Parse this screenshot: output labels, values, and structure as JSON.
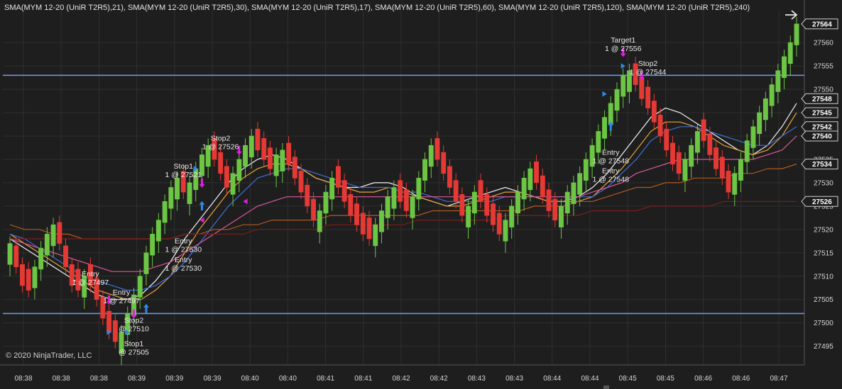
{
  "window": {
    "legend": "SMA(MYM 12-20 (UniR T2R5),21), SMA(MYM 12-20 (UniR T2R5),30), SMA(MYM 12-20 (UniR T2R5),17), SMA(MYM 12-20 (UniR T2R5),60), SMA(MYM 12-20 (UniR T2R5),120), SMA(MYM 12-20 (UniR T2R5),240)",
    "copyright": "© 2020 NinjaTrader, LLC",
    "nav_icon": "arrow-right-icon"
  },
  "colors": {
    "background": "#1e1e1e",
    "grid": "#2f2f2f",
    "up": "#6cc644",
    "down": "#e53935",
    "level_line": "#6f95e8",
    "marker_long": "#2e8be8",
    "marker_short": "#e020e0"
  },
  "chart_data": {
    "type": "candlestick",
    "instrument": "MYM 12-20 (UniR T2R5)",
    "ylim": [
      27491,
      27567
    ],
    "y_ticks": [
      27495,
      27500,
      27505,
      27510,
      27515,
      27520,
      27525,
      27530,
      27535,
      27540,
      27545,
      27550,
      27555,
      27560
    ],
    "x_tick_labels": [
      "08:38",
      "08:38",
      "08:38",
      "08:39",
      "08:39",
      "08:39",
      "08:40",
      "08:40",
      "08:41",
      "08:41",
      "08:42",
      "08:42",
      "08:43",
      "08:43",
      "08:44",
      "08:44",
      "08:45",
      "08:45",
      "08:46",
      "08:46",
      "08:47"
    ],
    "price_labels": [
      {
        "value": 27564,
        "text": "27564",
        "bg": "#1e1e1e",
        "fg": "#ffffff"
      },
      {
        "value": 27548,
        "text": "27548",
        "bg": "#1e1e1e",
        "fg": "#ffffff"
      },
      {
        "value": 27545,
        "text": "27545",
        "bg": "#1e1e1e",
        "fg": "#ffffff"
      },
      {
        "value": 27542,
        "text": "27542",
        "bg": "#1e1e1e",
        "fg": "#ffffff"
      },
      {
        "value": 27540,
        "text": "27540",
        "bg": "#1e1e1e",
        "fg": "#ffffff"
      },
      {
        "value": 27534,
        "text": "27534",
        "bg": "#1e1e1e",
        "fg": "#ffffff"
      },
      {
        "value": 27526,
        "text": "27526",
        "bg": "#1e1e1e",
        "fg": "#ffffff"
      }
    ],
    "horizontal_levels": [
      27553,
      27502
    ],
    "close_path": [
      27517,
      27512,
      27508,
      27507,
      27512,
      27516,
      27519,
      27521,
      27517,
      27512,
      27508,
      27507,
      27510,
      27508,
      27505,
      27501,
      27498,
      27496,
      27498,
      27502,
      27506,
      27510,
      27515,
      27519,
      27522,
      27526,
      27529,
      27531,
      27528,
      27530,
      27533,
      27536,
      27538,
      27535,
      27532,
      27529,
      27532,
      27535,
      27538,
      27540,
      27537,
      27535,
      27533,
      27536,
      27537,
      27534,
      27531,
      27528,
      27525,
      27522,
      27524,
      27528,
      27531,
      27529,
      27526,
      27523,
      27521,
      27519,
      27518,
      27521,
      27524,
      27527,
      27529,
      27526,
      27524,
      27527,
      27531,
      27535,
      27538,
      27535,
      27532,
      27529,
      27526,
      27523,
      27525,
      27528,
      27526,
      27523,
      27521,
      27519,
      27522,
      27525,
      27528,
      27531,
      27533,
      27530,
      27527,
      27524,
      27522,
      27525,
      27528,
      27530,
      27532,
      27535,
      27538,
      27541,
      27544,
      27547,
      27550,
      27553,
      27554,
      27551,
      27548,
      27546,
      27543,
      27540,
      27537,
      27534,
      27532,
      27535,
      27538,
      27541,
      27539,
      27536,
      27533,
      27531,
      27528,
      27532,
      27535,
      27539,
      27542,
      27545,
      27548,
      27551,
      27554,
      27557,
      27560,
      27564
    ],
    "series": [
      {
        "name": "SMA(MYM 12-20 (UniR T2R5),17)",
        "color": "#f2f2f2",
        "values": [
          27518,
          27516,
          27514,
          27512,
          27510,
          27508,
          27506,
          27505,
          27505,
          27506,
          27509,
          27513,
          27518,
          27522,
          27526,
          27530,
          27533,
          27535,
          27536,
          27535,
          27533,
          27531,
          27530,
          27529,
          27529,
          27530,
          27530,
          27529,
          27527,
          27526,
          27525,
          27526,
          27527,
          27528,
          27529,
          27528,
          27527,
          27526,
          27526,
          27527,
          27529,
          27532,
          27536,
          27540,
          27544,
          27546,
          27545,
          27543,
          27541,
          27539,
          27537,
          27536,
          27538,
          27542,
          27547
        ]
      },
      {
        "name": "SMA(MYM 12-20 (UniR T2R5),21)",
        "color": "#e8a23a",
        "values": [
          27519,
          27517,
          27515,
          27513,
          27511,
          27509,
          27507,
          27506,
          27505,
          27505,
          27507,
          27510,
          27515,
          27520,
          27524,
          27528,
          27531,
          27533,
          27534,
          27534,
          27533,
          27531,
          27530,
          27529,
          27528,
          27528,
          27529,
          27528,
          27527,
          27526,
          27525,
          27525,
          27526,
          27527,
          27528,
          27528,
          27527,
          27526,
          27526,
          27526,
          27527,
          27530,
          27533,
          27537,
          27541,
          27543,
          27543,
          27542,
          27540,
          27538,
          27537,
          27536,
          27537,
          27540,
          27545
        ]
      },
      {
        "name": "SMA(MYM 12-20 (UniR T2R5),30)",
        "color": "#3f6fd8",
        "values": [
          27519,
          27518,
          27516,
          27514,
          27512,
          27510,
          27509,
          27508,
          27507,
          27507,
          27508,
          27510,
          27513,
          27517,
          27521,
          27525,
          27528,
          27531,
          27532,
          27533,
          27533,
          27532,
          27531,
          27530,
          27529,
          27529,
          27529,
          27528,
          27528,
          27527,
          27526,
          27526,
          27526,
          27526,
          27527,
          27527,
          27527,
          27527,
          27527,
          27527,
          27527,
          27529,
          27532,
          27535,
          27539,
          27541,
          27542,
          27542,
          27541,
          27540,
          27539,
          27538,
          27538,
          27540,
          27542
        ]
      },
      {
        "name": "SMA(MYM 12-20 (UniR T2R5),60)",
        "color": "#d9579a",
        "values": [
          27518,
          27517,
          27516,
          27515,
          27514,
          27513,
          27512,
          27511,
          27511,
          27511,
          27512,
          27513,
          27515,
          27517,
          27519,
          27521,
          27523,
          27525,
          27526,
          27527,
          27527,
          27527,
          27527,
          27527,
          27527,
          27527,
          27527,
          27527,
          27527,
          27527,
          27527,
          27527,
          27527,
          27527,
          27527,
          27527,
          27527,
          27527,
          27527,
          27527,
          27528,
          27529,
          27530,
          27532,
          27533,
          27534,
          27535,
          27535,
          27535,
          27535,
          27535,
          27535,
          27536,
          27537,
          27540
        ]
      },
      {
        "name": "SMA(MYM 12-20 (UniR T2R5),120)",
        "color": "#b2581e",
        "values": [
          27521,
          27520,
          27520,
          27519,
          27519,
          27518,
          27518,
          27518,
          27518,
          27518,
          27518,
          27518,
          27519,
          27519,
          27520,
          27520,
          27521,
          27521,
          27522,
          27522,
          27522,
          27522,
          27523,
          27523,
          27523,
          27523,
          27523,
          27523,
          27523,
          27524,
          27524,
          27524,
          27524,
          27524,
          27524,
          27524,
          27525,
          27525,
          27525,
          27526,
          27526,
          27527,
          27528,
          27529,
          27529,
          27530,
          27530,
          27531,
          27531,
          27531,
          27532,
          27532,
          27533,
          27533,
          27534
        ]
      },
      {
        "name": "SMA(MYM 12-20 (UniR T2R5),240)",
        "color": "#7a1d1d",
        "values": [
          27518,
          27518,
          27518,
          27518,
          27518,
          27518,
          27518,
          27518,
          27518,
          27518,
          27518,
          27518,
          27519,
          27519,
          27519,
          27519,
          27519,
          27520,
          27520,
          27520,
          27520,
          27520,
          27521,
          27521,
          27521,
          27521,
          27521,
          27521,
          27522,
          27522,
          27522,
          27522,
          27522,
          27522,
          27523,
          27523,
          27523,
          27523,
          27523,
          27523,
          27524,
          27524,
          27524,
          27524,
          27525,
          27525,
          27525,
          27525,
          27525,
          27526,
          27526,
          27526,
          27526,
          27526,
          27526
        ]
      }
    ],
    "annotations": [
      {
        "lines": [
          "Entry",
          "1 @ 27497"
        ],
        "value": 27510,
        "bar": 13
      },
      {
        "lines": [
          "Entry",
          "1 @ 27497"
        ],
        "value": 27506,
        "bar": 18
      },
      {
        "lines": [
          "Stop2",
          "@ 27510"
        ],
        "value": 27500,
        "bar": 20
      },
      {
        "lines": [
          "Stop1",
          "@ 27505"
        ],
        "value": 27495,
        "bar": 20
      },
      {
        "lines": [
          "Stop1",
          "1 @ 27521"
        ],
        "value": 27533,
        "bar": 28
      },
      {
        "lines": [
          "Entry",
          "1 @ 27530"
        ],
        "value": 27517,
        "bar": 28
      },
      {
        "lines": [
          "Entry",
          "1 @ 27530"
        ],
        "value": 27513,
        "bar": 28
      },
      {
        "lines": [
          "Stop2",
          "1 @ 27526"
        ],
        "value": 27539,
        "bar": 34
      },
      {
        "lines": [
          "Target1",
          "1 @ 27556"
        ],
        "value": 27560,
        "bar": 99
      },
      {
        "lines": [
          "Stop2",
          "1 @ 27544"
        ],
        "value": 27555,
        "bar": 103
      },
      {
        "lines": [
          "Entry",
          "1 @ 27548"
        ],
        "value": 27536,
        "bar": 97
      },
      {
        "lines": [
          "Entry",
          "1 @ 27548"
        ],
        "value": 27532,
        "bar": 97
      }
    ],
    "markers": [
      {
        "bar": 16,
        "value": 27505,
        "dir": "down",
        "type": "arrow"
      },
      {
        "bar": 20,
        "value": 27502,
        "dir": "down",
        "type": "arrow"
      },
      {
        "bar": 22,
        "value": 27503,
        "dir": "up",
        "type": "arrow"
      },
      {
        "bar": 31,
        "value": 27525,
        "dir": "up",
        "type": "arrow"
      },
      {
        "bar": 31,
        "value": 27530,
        "dir": "down",
        "type": "arrow"
      },
      {
        "bar": 37,
        "value": 27537,
        "dir": "down",
        "type": "arrow"
      },
      {
        "bar": 97,
        "value": 27542,
        "dir": "up",
        "type": "arrow"
      },
      {
        "bar": 99,
        "value": 27558,
        "dir": "down",
        "type": "arrow"
      },
      {
        "bar": 102,
        "value": 27553,
        "dir": "down",
        "type": "arrow"
      },
      {
        "bar": 16,
        "value": 27498,
        "dir": "right",
        "type": "tri"
      },
      {
        "bar": 19,
        "value": 27498,
        "dir": "right",
        "type": "tri"
      },
      {
        "bar": 30,
        "value": 27533,
        "dir": "right",
        "type": "tri"
      },
      {
        "bar": 31,
        "value": 27522,
        "dir": "left",
        "type": "tri"
      },
      {
        "bar": 38,
        "value": 27526,
        "dir": "left",
        "type": "tri"
      },
      {
        "bar": 96,
        "value": 27549,
        "dir": "right",
        "type": "tri"
      },
      {
        "bar": 99,
        "value": 27555,
        "dir": "right",
        "type": "tri"
      }
    ]
  }
}
